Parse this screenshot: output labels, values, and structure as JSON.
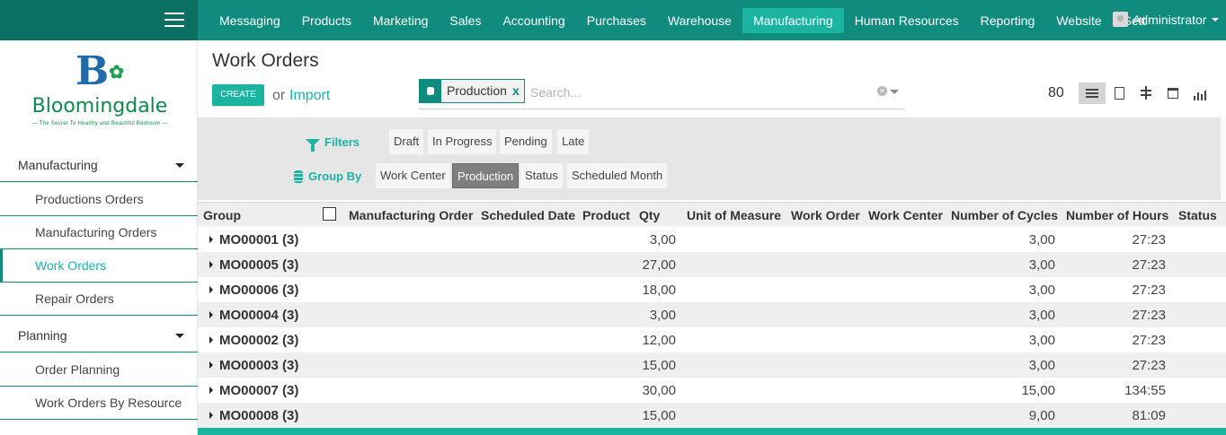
{
  "topbar": {
    "menu": [
      "Messaging",
      "Products",
      "Marketing",
      "Sales",
      "Accounting",
      "Purchases",
      "Warehouse",
      "Manufacturing",
      "Human Resources",
      "Reporting",
      "Website",
      "Settings"
    ],
    "active_menu": "Manufacturing",
    "user": "Administrator"
  },
  "sidebar": {
    "logo": {
      "mark": "B",
      "name": "Bloomingdale",
      "tagline": "— The Secret To Healthy and Beautiful Bedroom —"
    },
    "sections": [
      {
        "label": "Manufacturing",
        "items": [
          "Productions Orders",
          "Manufacturing Orders",
          "Work Orders",
          "Repair Orders"
        ]
      },
      {
        "label": "Planning",
        "items": [
          "Order Planning",
          "Work Orders By Resource"
        ]
      }
    ],
    "active_item": "Work Orders"
  },
  "control": {
    "title": "Work Orders",
    "create_label": "CREATE",
    "or_label": "or",
    "import_label": "Import",
    "facet_value": "Production",
    "facet_remove": "x",
    "search_placeholder": "Search...",
    "record_count": "80"
  },
  "filters": {
    "filters_label": "Filters",
    "filter_options": [
      "Draft",
      "In Progress",
      "Pending",
      "Late"
    ],
    "groupby_label": "Group By",
    "groupby_options": [
      "Work Center",
      "Production",
      "Status",
      "Scheduled Month"
    ],
    "selected_groupby": "Production"
  },
  "table": {
    "columns": [
      "Group",
      "Manufacturing Order",
      "Scheduled Date",
      "Product",
      "Qty",
      "Unit of Measure",
      "Work Order",
      "Work Center",
      "Number of Cycles",
      "Number of Hours",
      "Status"
    ],
    "rows": [
      {
        "group": "MO00001 (3)",
        "qty": "3,00",
        "cycles": "3,00",
        "hours": "27:23"
      },
      {
        "group": "MO00005 (3)",
        "qty": "27,00",
        "cycles": "3,00",
        "hours": "27:23"
      },
      {
        "group": "MO00006 (3)",
        "qty": "18,00",
        "cycles": "3,00",
        "hours": "27:23"
      },
      {
        "group": "MO00004 (3)",
        "qty": "3,00",
        "cycles": "3,00",
        "hours": "27:23"
      },
      {
        "group": "MO00002 (3)",
        "qty": "12,00",
        "cycles": "3,00",
        "hours": "27:23"
      },
      {
        "group": "MO00003 (3)",
        "qty": "15,00",
        "cycles": "3,00",
        "hours": "27:23"
      },
      {
        "group": "MO00007 (3)",
        "qty": "30,00",
        "cycles": "15,00",
        "hours": "134:55"
      },
      {
        "group": "MO00008 (3)",
        "qty": "15,00",
        "cycles": "9,00",
        "hours": "81:09"
      }
    ]
  },
  "colors": {
    "brand": "#0f8c7d",
    "accent": "#1ab4a1"
  }
}
